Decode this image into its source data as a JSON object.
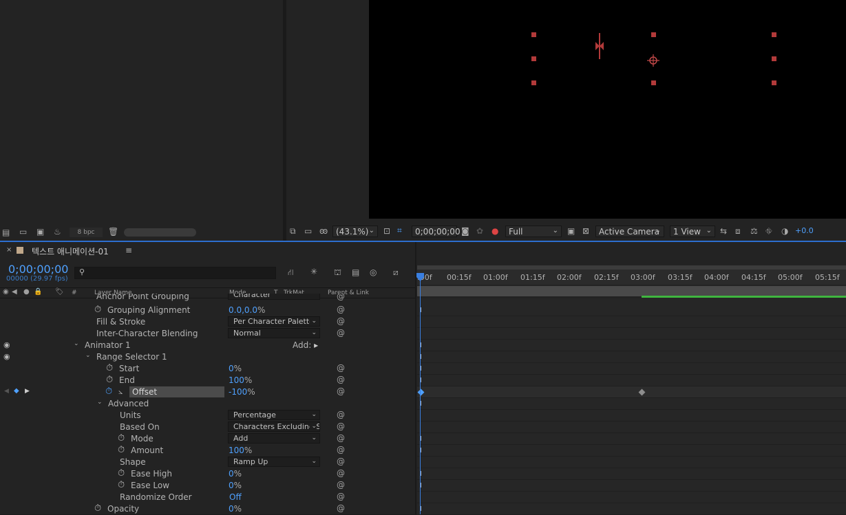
{
  "project_footer": {
    "bpc": "8 bpc"
  },
  "viewer_toolbar": {
    "zoom": "(43.1%)",
    "timecode": "0;00;00;00",
    "resolution": "Full",
    "camera": "Active Camera",
    "view": "1 View",
    "exposure": "+0.0"
  },
  "timeline": {
    "comp_name": "텍스트 애니메이션-01",
    "timecode": "0;00;00;00",
    "fps": "00000 (29.97 fps)",
    "header": {
      "col_hash": "#",
      "layer_name": "Layer Name",
      "mode": "Mode",
      "t": "T",
      "trkmat": "TrkMat",
      "parent": "Parent & Link"
    },
    "ruler_ticks": [
      ":00f",
      "00:15f",
      "01:00f",
      "01:15f",
      "02:00f",
      "02:15f",
      "03:00f",
      "03:15f",
      "04:00f",
      "04:15f",
      "05:00f",
      "05:15f"
    ],
    "rows": [
      {
        "label": "Anchor Point Grouping",
        "dropdown": "Character"
      },
      {
        "label": "Grouping Alignment",
        "value": "0.0,0.0",
        "unit": "%"
      },
      {
        "label": "Fill & Stroke",
        "dropdown": "Per Character Palette"
      },
      {
        "label": "Inter-Character Blending",
        "dropdown": "Normal"
      },
      {
        "label": "Animator 1",
        "add_label": "Add:"
      },
      {
        "label": "Range Selector 1"
      },
      {
        "label": "Start",
        "value": "0",
        "unit": "%"
      },
      {
        "label": "End",
        "value": "100",
        "unit": "%"
      },
      {
        "label": "Offset",
        "value": "-100",
        "unit": "%"
      },
      {
        "label": "Advanced"
      },
      {
        "label": "Units",
        "dropdown": "Percentage"
      },
      {
        "label": "Based On",
        "dropdown": "Characters Excluding S"
      },
      {
        "label": "Mode",
        "dropdown": "Add"
      },
      {
        "label": "Amount",
        "value": "100",
        "unit": "%"
      },
      {
        "label": "Shape",
        "dropdown": "Ramp Up"
      },
      {
        "label": "Ease High",
        "value": "0",
        "unit": "%"
      },
      {
        "label": "Ease Low",
        "value": "0",
        "unit": "%"
      },
      {
        "label": "Randomize Order",
        "value": "Off"
      },
      {
        "label": "Opacity",
        "value": "0",
        "unit": "%"
      }
    ]
  },
  "colors": {
    "accent": "#4fa1ff",
    "handle": "#b23a3a",
    "workarea": "#3fb63f"
  }
}
